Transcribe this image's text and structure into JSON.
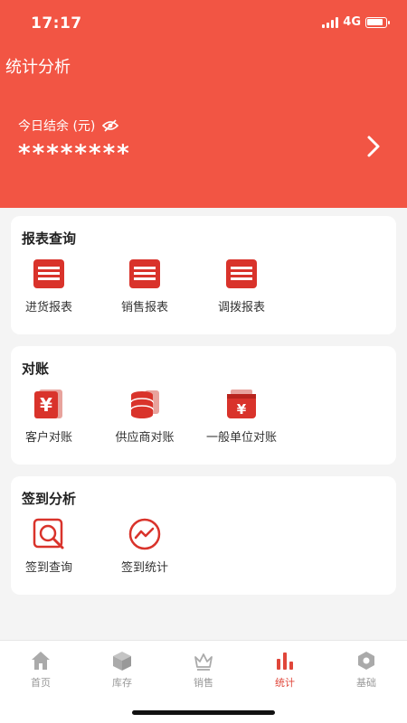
{
  "status": {
    "time": "17:17",
    "network": "4G",
    "battery_level": 0.9
  },
  "header": {
    "title": "统计分析",
    "balance_label": "今日结余 (元)",
    "balance_value": "********"
  },
  "sections": [
    {
      "title": "报表查询",
      "items": [
        {
          "label": "进货报表",
          "icon": "report-icon"
        },
        {
          "label": "销售报表",
          "icon": "report-icon"
        },
        {
          "label": "调拨报表",
          "icon": "report-icon"
        }
      ]
    },
    {
      "title": "对账",
      "items": [
        {
          "label": "客户对账",
          "icon": "yen-document-icon"
        },
        {
          "label": "供应商对账",
          "icon": "coin-stack-icon"
        },
        {
          "label": "一般单位对账",
          "icon": "yen-wallet-icon"
        }
      ]
    },
    {
      "title": "签到分析",
      "items": [
        {
          "label": "签到查询",
          "icon": "search-document-icon"
        },
        {
          "label": "签到统计",
          "icon": "trend-chart-icon"
        }
      ]
    }
  ],
  "tabbar": {
    "active": "统计",
    "tabs": [
      {
        "label": "首页",
        "icon": "home-icon"
      },
      {
        "label": "库存",
        "icon": "box-icon"
      },
      {
        "label": "销售",
        "icon": "crown-icon"
      },
      {
        "label": "统计",
        "icon": "bar-chart-icon"
      },
      {
        "label": "基础",
        "icon": "hexagon-icon"
      }
    ]
  },
  "colors": {
    "primary": "#f25544",
    "icon_red": "#d9332b",
    "tab_active": "#e0463a",
    "tab_inactive": "#aaaaaa"
  }
}
